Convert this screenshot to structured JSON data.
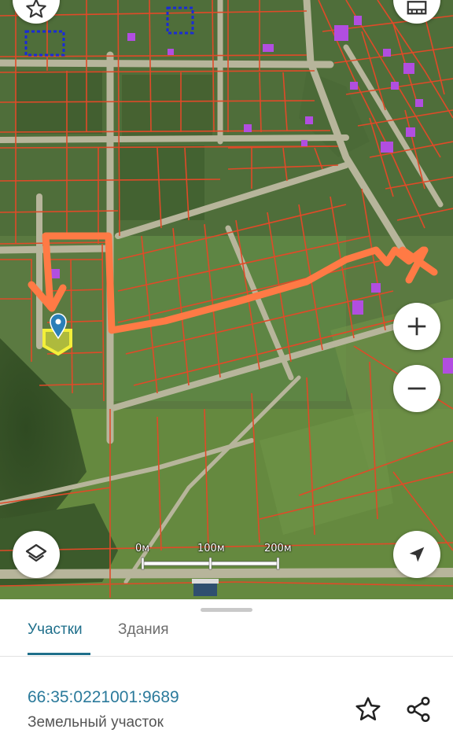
{
  "map": {
    "scale_labels": [
      "0м",
      "100м",
      "200м"
    ],
    "colors": {
      "parcel_border": "#e04a28",
      "route": "#ff7a45",
      "selected_parcel": "#f3ef3a",
      "pin": "#2a7fb8",
      "building": "#b14ee0"
    },
    "controls": {
      "top_left_icon": "star-icon",
      "top_right_icon": "map-layers-panel-icon",
      "zoom_in_icon": "plus-icon",
      "zoom_out_icon": "minus-icon",
      "layers_icon": "layers-icon",
      "locate_icon": "navigation-arrow-icon"
    }
  },
  "tabs": [
    {
      "label": "Участки",
      "active": true
    },
    {
      "label": "Здания",
      "active": false
    }
  ],
  "result": {
    "cadastral_number": "66:35:0221001:9689",
    "object_type": "Земельный участок"
  },
  "actions": {
    "favorite_icon": "star-outline-icon",
    "share_icon": "share-icon"
  }
}
